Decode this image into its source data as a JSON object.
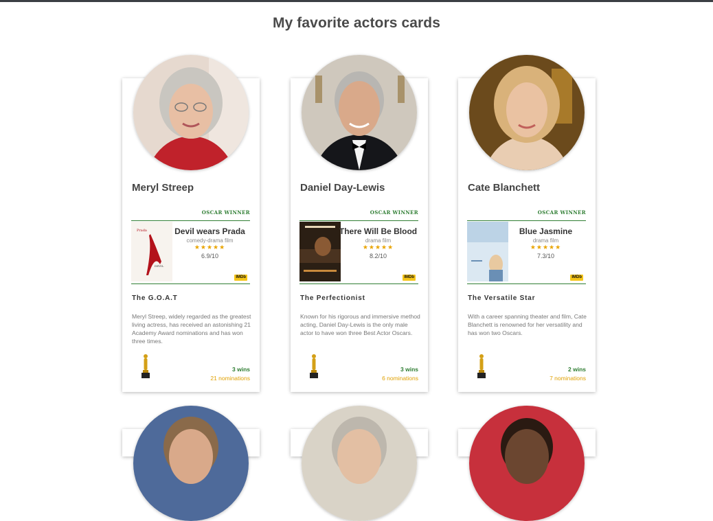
{
  "page": {
    "title": "My favorite actors cards"
  },
  "cards": [
    {
      "name": "Meryl Streep",
      "badge": "OSCAR WINNER",
      "movie": {
        "title": "Devil wears Prada",
        "genre": "comedy-drama film",
        "stars": "★★★★★",
        "rating": "6.9/10",
        "rating_value": 6.9,
        "imdb": "IMDb"
      },
      "subtitle": "The G.O.A.T",
      "description": "Meryl Streep, widely regarded as the greatest living actress, has received an astonishing 21 Academy Award nominations and has won three times.",
      "wins": "3 wins",
      "nominations": "21 nominations",
      "portrait": {
        "bg": "#d8746a",
        "hair": "#c9c6c0",
        "skin": "#e8bfa4",
        "cloth": "#c0222b"
      },
      "poster": {
        "bg": "#f7f3ee",
        "accent": "#b3121b"
      }
    },
    {
      "name": "Daniel Day-Lewis",
      "badge": "OSCAR WINNER",
      "movie": {
        "title": "There Will Be Blood",
        "genre": "drama film",
        "stars": "★★★★★",
        "rating": "8.2/10",
        "rating_value": 8.2,
        "imdb": "IMDb"
      },
      "subtitle": "The Perfectionist",
      "description": "Known for his rigorous and immersive method acting, Daniel Day-Lewis is the only male actor to have won three Best Actor Oscars.",
      "wins": "3 wins",
      "nominations": "6 nominations",
      "portrait": {
        "bg": "#cfc8bd",
        "hair": "#b8b6b2",
        "skin": "#d9a98a",
        "cloth": "#15161a"
      },
      "poster": {
        "bg": "#2b1f14",
        "accent": "#c98a3c"
      }
    },
    {
      "name": "Cate Blanchett",
      "badge": "OSCAR WINNER",
      "movie": {
        "title": "Blue Jasmine",
        "genre": "drama film",
        "stars": "★★★★★",
        "rating": "7.3/10",
        "rating_value": 7.3,
        "imdb": "IMDb"
      },
      "subtitle": "The Versatile Star",
      "description": "With a career spanning theater and film, Cate Blanchett is renowned for her versatility and has won two Oscars.",
      "wins": "2 wins",
      "nominations": "7 nominations",
      "portrait": {
        "bg": "#6b4a1c",
        "hair": "#d9b27a",
        "skin": "#eac2a2",
        "cloth": "#e9cdb2"
      },
      "poster": {
        "bg": "#dbe8f2",
        "accent": "#6a8fb5"
      }
    }
  ],
  "next_row": [
    {
      "portrait": {
        "bg": "#4e6a9a",
        "hair": "#8a6a4a",
        "skin": "#d9a98a"
      }
    },
    {
      "portrait": {
        "bg": "#d9d3c7",
        "hair": "#bdb7ad",
        "skin": "#e3bfa3"
      }
    },
    {
      "portrait": {
        "bg": "#c7303c",
        "hair": "#2a1a12",
        "skin": "#6b4630"
      }
    }
  ],
  "colors": {
    "green": "#2e7d32",
    "gold": "#e0a000",
    "star": "#e9a400",
    "imdb": "#f5c518"
  }
}
